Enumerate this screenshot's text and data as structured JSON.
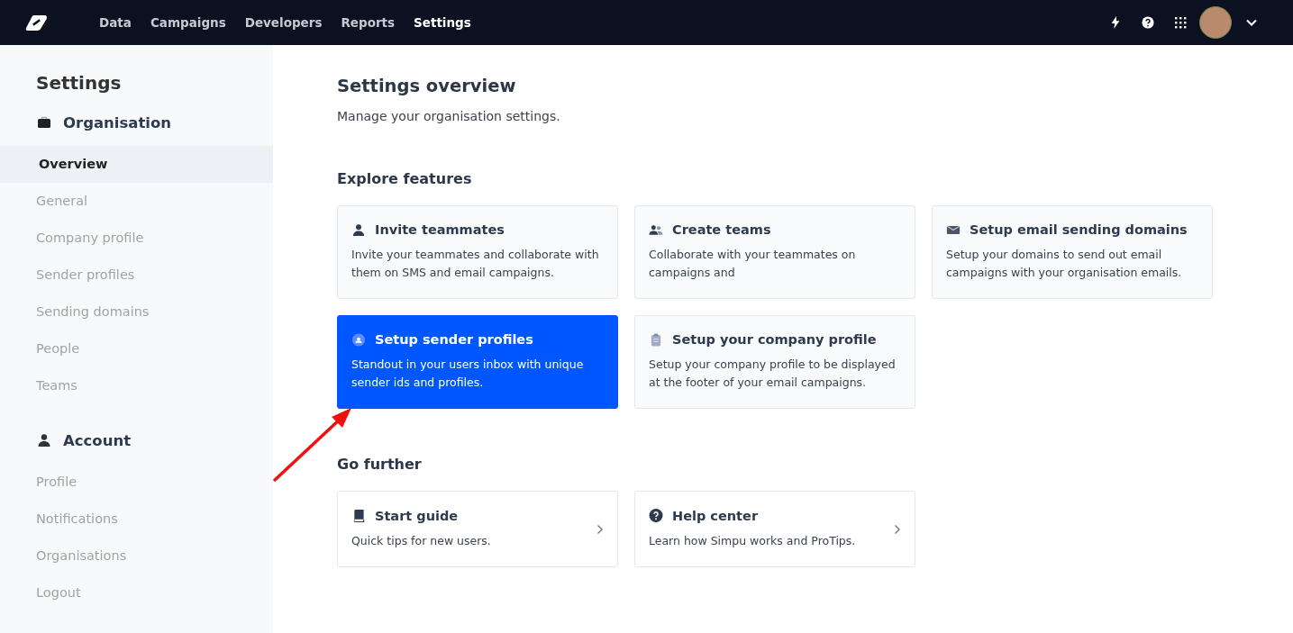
{
  "topbar": {
    "nav": [
      {
        "label": "Data",
        "selected": false
      },
      {
        "label": "Campaigns",
        "selected": false
      },
      {
        "label": "Developers",
        "selected": false
      },
      {
        "label": "Reports",
        "selected": false
      },
      {
        "label": "Settings",
        "selected": true
      }
    ]
  },
  "sidebar": {
    "title": "Settings",
    "sections": [
      {
        "heading": "Organisation",
        "kind": "briefcase",
        "items": [
          {
            "label": "Overview",
            "selected": true
          },
          {
            "label": "General",
            "selected": false
          },
          {
            "label": "Company profile",
            "selected": false
          },
          {
            "label": "Sender profiles",
            "selected": false
          },
          {
            "label": "Sending domains",
            "selected": false
          },
          {
            "label": "People",
            "selected": false
          },
          {
            "label": "Teams",
            "selected": false
          }
        ]
      },
      {
        "heading": "Account",
        "kind": "person",
        "items": [
          {
            "label": "Profile",
            "selected": false
          },
          {
            "label": "Notifications",
            "selected": false
          },
          {
            "label": "Organisations",
            "selected": false
          },
          {
            "label": "Logout",
            "selected": false
          }
        ]
      }
    ]
  },
  "main": {
    "title": "Settings overview",
    "subtitle": "Manage your organisation settings.",
    "explore": {
      "heading": "Explore features",
      "cards": [
        {
          "kind": "person",
          "title": "Invite teammates",
          "text": "Invite your teammates and collaborate with them on SMS and email campaigns.",
          "selected": false
        },
        {
          "kind": "people",
          "title": "Create teams",
          "text": "Collaborate with your teammates on campaigns and",
          "selected": false
        },
        {
          "kind": "envelope",
          "title": "Setup email sending domains",
          "text": "Setup your domains to send out email campaigns with your organisation emails.",
          "selected": false
        },
        {
          "kind": "badge",
          "title": "Setup sender profiles",
          "text": "Standout in your users inbox with unique sender ids and profiles.",
          "selected": true
        },
        {
          "kind": "clipboard",
          "title": "Setup your company profile",
          "text": "Setup your company profile to be displayed at the footer of your email campaigns.",
          "selected": false
        }
      ]
    },
    "further": {
      "heading": "Go further",
      "cards": [
        {
          "kind": "book",
          "title": "Start guide",
          "text": "Quick tips for new users."
        },
        {
          "kind": "help",
          "title": "Help center",
          "text": "Learn how Simpu works and ProTips."
        }
      ]
    }
  }
}
